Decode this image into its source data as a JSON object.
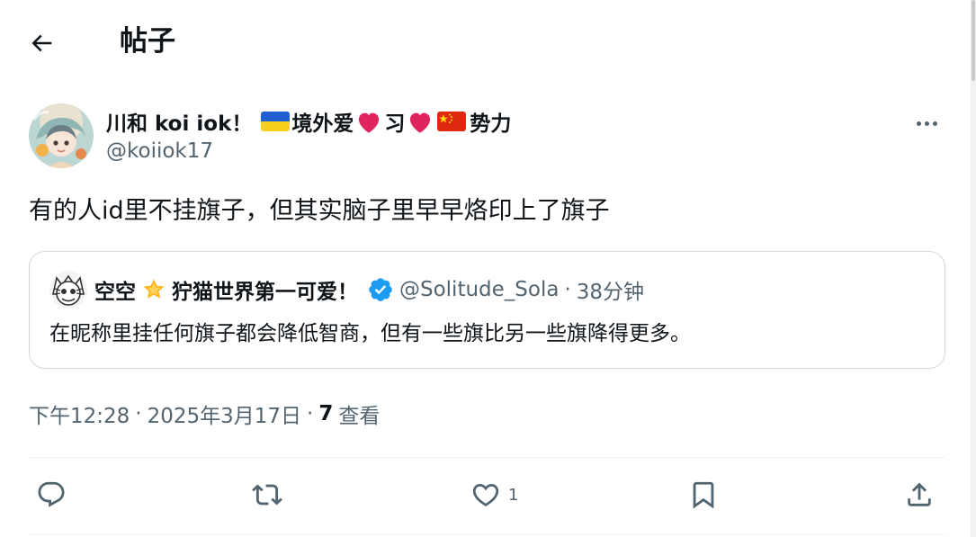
{
  "header": {
    "title": "帖子",
    "back_icon": "arrow-left-icon"
  },
  "author": {
    "name_parts": [
      "川和 koi iok！",
      "境外爱",
      "习",
      "势力"
    ],
    "flags": [
      "ukraine-flag-icon",
      "china-flag-icon"
    ],
    "heart_icon": "red-heart-icon",
    "handle": "@koiiok17",
    "more_icon": "more-dots-icon"
  },
  "tweet": {
    "text": "有的人id里不挂旗子，但其实脑子里早早烙印上了旗子"
  },
  "quote": {
    "name_prefix": "空空",
    "name_suffix": "狞猫世界第一可爱！",
    "star_icon": "glowing-star-icon",
    "verified_icon": "verified-badge-icon",
    "handle": "@Solitude_Sola",
    "dot": "·",
    "time": "38分钟",
    "text": "在昵称里挂任何旗子都会降低智商，但有一些旗比另一些旗降得更多。"
  },
  "meta": {
    "time": "下午12:28",
    "sep": "·",
    "date": "2025年3月17日",
    "views_count": "7",
    "views_label": "查看"
  },
  "actions": {
    "reply_icon": "reply-icon",
    "repost_icon": "repost-icon",
    "like_icon": "heart-outline-icon",
    "like_count": "1",
    "bookmark_icon": "bookmark-icon",
    "share_icon": "share-icon"
  },
  "colors": {
    "text": "#0f1419",
    "secondary": "#536471",
    "border": "#cfd9de",
    "verified": "#1d9bf0",
    "heart": "#e0245e"
  }
}
